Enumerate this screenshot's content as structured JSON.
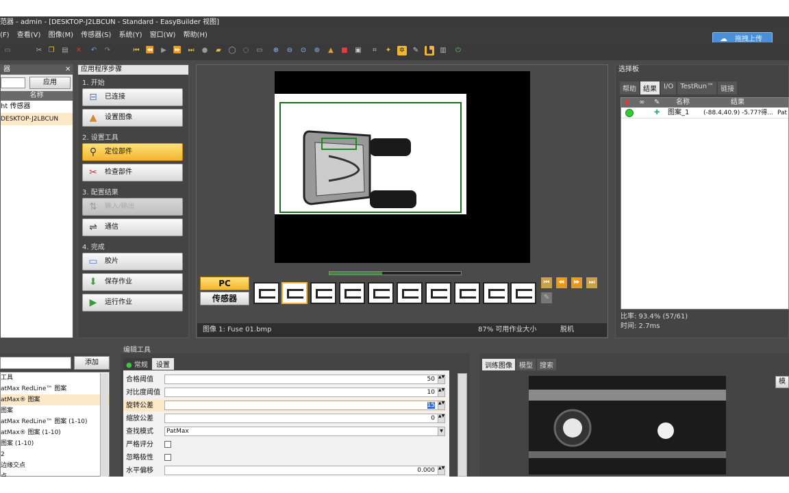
{
  "window": {
    "title": "范器 - admin - [DESKTOP-J2LBCUN - Standard - EasyBuilder 视图]"
  },
  "menu": [
    "(F)",
    "查看(V)",
    "图像(M)",
    "传感器(S)",
    "系统(Y)",
    "窗口(W)",
    "帮助(H)"
  ],
  "upload_button": "拖拽上传",
  "left_panel": {
    "title": "器",
    "apply": "应用",
    "column": "名称",
    "items": [
      "ht 传感器",
      "DESKTOP-J2LBCUN"
    ]
  },
  "steps": {
    "title": "应用程序步骤",
    "section1": "1. 开始",
    "connected": "已连接",
    "set_image": "设置图像",
    "section2": "2. 设置工具",
    "locate_part": "定位部件",
    "inspect_part": "检查部件",
    "section3": "3. 配置结果",
    "io": "输入/输出",
    "comm": "通信",
    "section4": "4. 完成",
    "filmstrip": "胶片",
    "save_job": "保存作业",
    "run_job": "运行作业"
  },
  "image_view": {
    "pc_label": "PC",
    "sensor_label": "传感器",
    "status_image": "图像 1: Fuse 01.bmp",
    "status_job": "87% 可用作业大小",
    "status_mode": "脱机"
  },
  "palette": {
    "title": "选择板",
    "tabs": [
      "帮助",
      "结果",
      "I/O",
      "TestRun™",
      "链接"
    ],
    "columns": [
      "名称",
      "结果"
    ],
    "row": {
      "name": "图案_1",
      "result": "(-88.4,40.9) -5.77?得...",
      "extra": "Pat"
    },
    "pass_rate": "比率: 93.4% (57/61)",
    "time": "时间: 2.7ms"
  },
  "tools": {
    "add": "添加",
    "items": [
      "工具",
      "atMax RedLine™ 图案",
      "atMax® 图案",
      "图案",
      "atMax RedLine™ 图案 (1-10)",
      "atMax® 图案 (1-10)",
      "图案 (1-10)",
      "2",
      "边缘交点",
      "点"
    ]
  },
  "edit": {
    "title": "编辑工具",
    "tabs": [
      "常规",
      "设置"
    ],
    "params": [
      {
        "label": "合格阈值",
        "value": "50"
      },
      {
        "label": "对比度阈值",
        "value": "10"
      },
      {
        "label": "旋转公差",
        "value": "15"
      },
      {
        "label": "缩放公差",
        "value": "0"
      },
      {
        "label": "查找模式",
        "value": "PatMax"
      },
      {
        "label": "严格评分",
        "value": ""
      },
      {
        "label": "忽略极性",
        "value": ""
      },
      {
        "label": "水平偏移",
        "value": "0.000"
      }
    ]
  },
  "train": {
    "tabs": [
      "训练图像",
      "模型",
      "搜索"
    ],
    "side": "模"
  }
}
